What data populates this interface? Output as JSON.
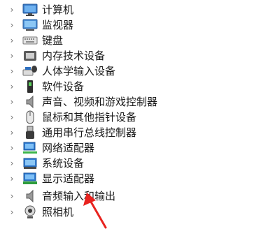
{
  "tree": {
    "items": [
      {
        "label": "计算机",
        "icon": "computer-icon"
      },
      {
        "label": "监视器",
        "icon": "monitor-icon"
      },
      {
        "label": "键盘",
        "icon": "keyboard-icon"
      },
      {
        "label": "内存技术设备",
        "icon": "memory-device-icon"
      },
      {
        "label": "人体学输入设备",
        "icon": "hid-icon"
      },
      {
        "label": "软件设备",
        "icon": "software-device-icon"
      },
      {
        "label": "声音、视频和游戏控制器",
        "icon": "speaker-icon"
      },
      {
        "label": "鼠标和其他指针设备",
        "icon": "mouse-icon"
      },
      {
        "label": "通用串行总线控制器",
        "icon": "usb-icon"
      },
      {
        "label": "网络适配器",
        "icon": "network-adapter-icon"
      },
      {
        "label": "系统设备",
        "icon": "system-device-icon"
      },
      {
        "label": "显示适配器",
        "icon": "display-adapter-icon"
      },
      {
        "label": "音频输入和输出",
        "icon": "audio-io-icon"
      },
      {
        "label": "照相机",
        "icon": "camera-icon"
      }
    ],
    "expand_glyph": "›"
  },
  "annotation": {
    "arrow_color": "#e8231f"
  }
}
